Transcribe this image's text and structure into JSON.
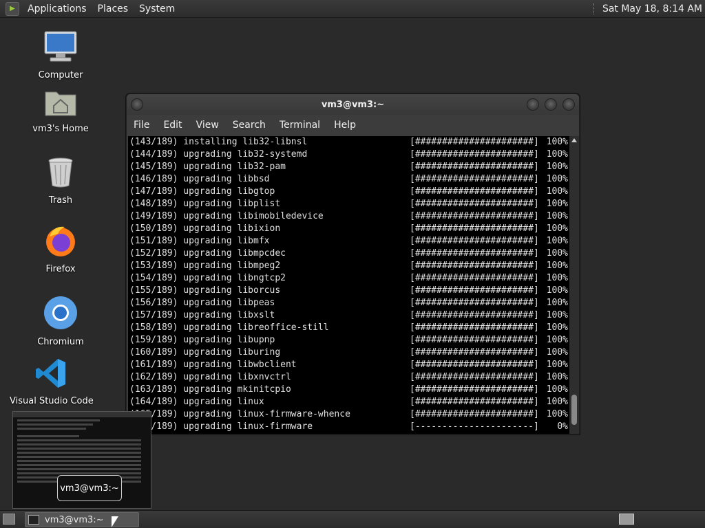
{
  "top_panel": {
    "menus": [
      "Applications",
      "Places",
      "System"
    ],
    "clock": "Sat May 18,  8:14 AM"
  },
  "desktop": {
    "icons": [
      {
        "label": "Computer",
        "icon": "computer-icon"
      },
      {
        "label": "vm3's Home",
        "icon": "home-folder-icon"
      },
      {
        "label": "Trash",
        "icon": "trash-icon"
      },
      {
        "label": "Firefox",
        "icon": "firefox-icon"
      },
      {
        "label": "Chromium",
        "icon": "chromium-icon"
      },
      {
        "label": "Visual Studio Code",
        "icon": "vscode-icon"
      }
    ]
  },
  "terminal": {
    "title": "vm3@vm3:~",
    "menu": [
      "File",
      "Edit",
      "View",
      "Search",
      "Terminal",
      "Help"
    ],
    "lines": [
      {
        "text": "(143/189) installing lib32-libnsl",
        "bar": "[######################]",
        "pct": "100%"
      },
      {
        "text": "(144/189) upgrading lib32-systemd",
        "bar": "[######################]",
        "pct": "100%"
      },
      {
        "text": "(145/189) upgrading lib32-pam",
        "bar": "[######################]",
        "pct": "100%"
      },
      {
        "text": "(146/189) upgrading libbsd",
        "bar": "[######################]",
        "pct": "100%"
      },
      {
        "text": "(147/189) upgrading libgtop",
        "bar": "[######################]",
        "pct": "100%"
      },
      {
        "text": "(148/189) upgrading libplist",
        "bar": "[######################]",
        "pct": "100%"
      },
      {
        "text": "(149/189) upgrading libimobiledevice",
        "bar": "[######################]",
        "pct": "100%"
      },
      {
        "text": "(150/189) upgrading libixion",
        "bar": "[######################]",
        "pct": "100%"
      },
      {
        "text": "(151/189) upgrading libmfx",
        "bar": "[######################]",
        "pct": "100%"
      },
      {
        "text": "(152/189) upgrading libmpcdec",
        "bar": "[######################]",
        "pct": "100%"
      },
      {
        "text": "(153/189) upgrading libmpeg2",
        "bar": "[######################]",
        "pct": "100%"
      },
      {
        "text": "(154/189) upgrading libngtcp2",
        "bar": "[######################]",
        "pct": "100%"
      },
      {
        "text": "(155/189) upgrading liborcus",
        "bar": "[######################]",
        "pct": "100%"
      },
      {
        "text": "(156/189) upgrading libpeas",
        "bar": "[######################]",
        "pct": "100%"
      },
      {
        "text": "(157/189) upgrading libxslt",
        "bar": "[######################]",
        "pct": "100%"
      },
      {
        "text": "(158/189) upgrading libreoffice-still",
        "bar": "[######################]",
        "pct": "100%"
      },
      {
        "text": "(159/189) upgrading libupnp",
        "bar": "[######################]",
        "pct": "100%"
      },
      {
        "text": "(160/189) upgrading liburing",
        "bar": "[######################]",
        "pct": "100%"
      },
      {
        "text": "(161/189) upgrading libwbclient",
        "bar": "[######################]",
        "pct": "100%"
      },
      {
        "text": "(162/189) upgrading libxnvctrl",
        "bar": "[######################]",
        "pct": "100%"
      },
      {
        "text": "(163/189) upgrading mkinitcpio",
        "bar": "[######################]",
        "pct": "100%"
      },
      {
        "text": "(164/189) upgrading linux",
        "bar": "[######################]",
        "pct": "100%"
      },
      {
        "text": "(165/189) upgrading linux-firmware-whence",
        "bar": "[######################]",
        "pct": "100%"
      },
      {
        "text": "(166/189) upgrading linux-firmware",
        "bar": "[----------------------]",
        "pct": "0%"
      }
    ]
  },
  "tooltip": "vm3@vm3:~",
  "taskbar": {
    "task_label": "vm3@vm3:~"
  }
}
